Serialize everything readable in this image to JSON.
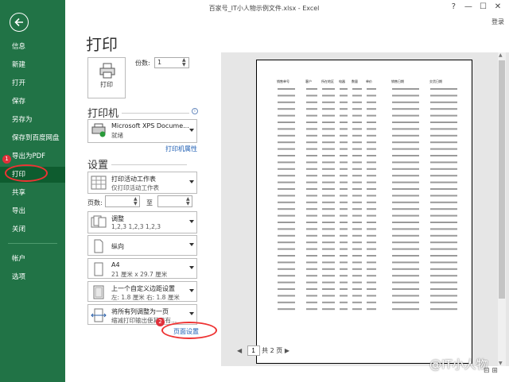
{
  "window": {
    "title": "百家号_IT小人物示例文件.xlsx - Excel",
    "controls": [
      "?",
      "—",
      "☐",
      "✕"
    ],
    "login": "登录"
  },
  "sidebar": {
    "items": [
      {
        "label": "信息"
      },
      {
        "label": "新建"
      },
      {
        "label": "打开"
      },
      {
        "label": "保存"
      },
      {
        "label": "另存为"
      },
      {
        "label": "保存到百度网盘"
      },
      {
        "label": "导出为PDF"
      },
      {
        "label": "打印"
      },
      {
        "label": "共享"
      },
      {
        "label": "导出"
      },
      {
        "label": "关闭"
      },
      {
        "label": "帐户"
      },
      {
        "label": "选项"
      }
    ],
    "active": "打印",
    "badges": [
      "1",
      "2"
    ]
  },
  "print": {
    "title": "打印",
    "print_button": "打印",
    "copies_label": "份数:",
    "copies_value": "1"
  },
  "printer": {
    "heading": "打印机",
    "name": "Microsoft XPS Docume...",
    "status": "就绪",
    "properties_link": "打印机属性"
  },
  "settings": {
    "heading": "设置",
    "scope": {
      "title": "打印活动工作表",
      "sub": "仅打印活动工作表"
    },
    "pages_label": "页数:",
    "to_label": "至",
    "collate": {
      "title": "调整",
      "sub": "1,2,3    1,2,3    1,2,3"
    },
    "orientation": {
      "title": "纵向"
    },
    "paper": {
      "title": "A4",
      "sub": "21 厘米 x 29.7 厘米"
    },
    "margins": {
      "title": "上一个自定义边距设置",
      "sub": "左: 1.8 厘米    右: 1.8 厘米"
    },
    "scaling": {
      "title": "将所有列调整为一页",
      "sub": "缩减打印输出使其只有..."
    },
    "page_setup_link": "页面设置"
  },
  "preview": {
    "headers": [
      "销售单号",
      "客户",
      "所在地区",
      "电器",
      "数量",
      "单价",
      "销售日期",
      "交货日期"
    ],
    "rows": 34,
    "page_current": "1",
    "page_total": "共 2 页"
  },
  "watermark": "@IT小人物",
  "colors": {
    "sidebar": "#217346",
    "sidebar_active": "#0e5c2f",
    "annotation": "#e33333",
    "link": "#1f5fb4"
  }
}
